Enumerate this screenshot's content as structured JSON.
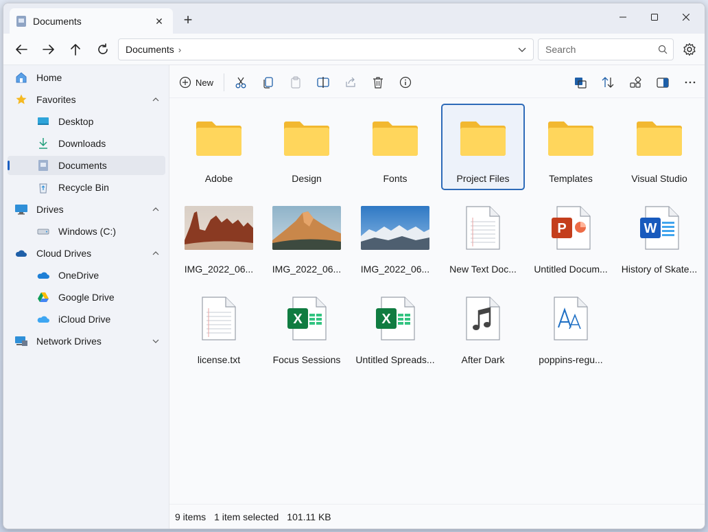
{
  "window": {
    "tab_title": "Documents",
    "tab_close": "✕",
    "new_tab": "+"
  },
  "navbar": {
    "address": "Documents",
    "address_sep": "›",
    "search_placeholder": "Search"
  },
  "sidebar": {
    "items": [
      {
        "label": "Home",
        "icon": "home-icon"
      },
      {
        "label": "Favorites",
        "icon": "star-icon",
        "expanded": true
      },
      {
        "label": "Desktop",
        "icon": "desktop-icon"
      },
      {
        "label": "Downloads",
        "icon": "download-icon"
      },
      {
        "label": "Documents",
        "icon": "documents-icon",
        "active": true
      },
      {
        "label": "Recycle Bin",
        "icon": "recycle-bin-icon"
      },
      {
        "label": "Drives",
        "icon": "drive-icon",
        "expanded": true
      },
      {
        "label": "Windows (C:)",
        "icon": "hard-disk-icon"
      },
      {
        "label": "Cloud Drives",
        "icon": "cloud-drive-icon",
        "expanded": true
      },
      {
        "label": "OneDrive",
        "icon": "onedrive-icon"
      },
      {
        "label": "Google Drive",
        "icon": "google-drive-icon"
      },
      {
        "label": "iCloud Drive",
        "icon": "icloud-icon"
      },
      {
        "label": "Network Drives",
        "icon": "network-drive-icon",
        "expanded": false
      }
    ]
  },
  "toolbar": {
    "new_label": "New"
  },
  "files": [
    {
      "name": "Adobe",
      "type": "folder"
    },
    {
      "name": "Design",
      "type": "folder"
    },
    {
      "name": "Fonts",
      "type": "folder"
    },
    {
      "name": "Project Files",
      "type": "folder",
      "selected": true
    },
    {
      "name": "Templates",
      "type": "folder"
    },
    {
      "name": "Visual Studio",
      "type": "folder"
    },
    {
      "name": "IMG_2022_06...",
      "type": "photo-desert"
    },
    {
      "name": "IMG_2022_06...",
      "type": "photo-mountain"
    },
    {
      "name": "IMG_2022_06...",
      "type": "photo-snow"
    },
    {
      "name": "New Text Doc...",
      "type": "text"
    },
    {
      "name": "Untitled Docum...",
      "type": "powerpoint"
    },
    {
      "name": "History of Skate...",
      "type": "word"
    },
    {
      "name": "license.txt",
      "type": "text"
    },
    {
      "name": "Focus Sessions",
      "type": "excel"
    },
    {
      "name": "Untitled Spreads...",
      "type": "excel"
    },
    {
      "name": "After Dark",
      "type": "audio"
    },
    {
      "name": "poppins-regu...",
      "type": "font"
    }
  ],
  "status": {
    "count": "9 items",
    "selected": "1 item selected",
    "size": "101.11 KB"
  },
  "colors": {
    "accent": "#2d6ab8",
    "folder": "#f8c94a",
    "folder_front": "#ffd969"
  }
}
